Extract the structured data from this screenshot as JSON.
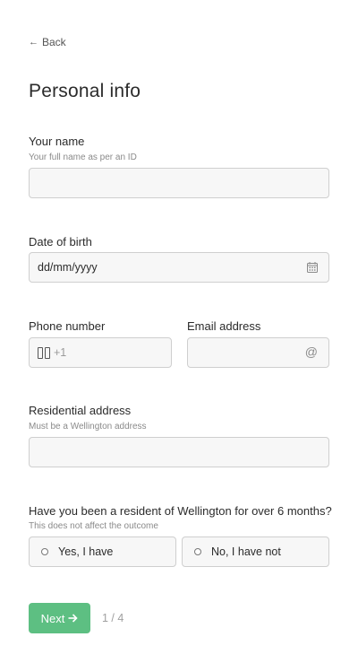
{
  "nav": {
    "back_label": "Back"
  },
  "page": {
    "title": "Personal info"
  },
  "fields": {
    "name": {
      "label": "Your name",
      "hint": "Your full name as per an ID",
      "value": ""
    },
    "dob": {
      "label": "Date of birth",
      "placeholder": "dd/mm/yyyy",
      "icon": "calendar-icon"
    },
    "phone": {
      "label": "Phone number",
      "country_code": "+1",
      "icon": "flag-icon"
    },
    "email": {
      "label": "Email address",
      "icon": "at-sign-icon",
      "icon_glyph": "@"
    },
    "address": {
      "label": "Residential address",
      "hint": "Must be a Wellington address",
      "value": ""
    }
  },
  "residency": {
    "question": "Have you been a resident of Wellington for over 6 months?",
    "hint": "This does not affect the outcome",
    "options": [
      "Yes, I have",
      "No, I have not"
    ]
  },
  "footer": {
    "next_label": "Next",
    "next_icon": "arrow-right-icon",
    "step": "1 / 4"
  },
  "colors": {
    "accent": "#5dbf82",
    "input_bg": "#f7f7f7",
    "border": "#cfcfcf"
  }
}
